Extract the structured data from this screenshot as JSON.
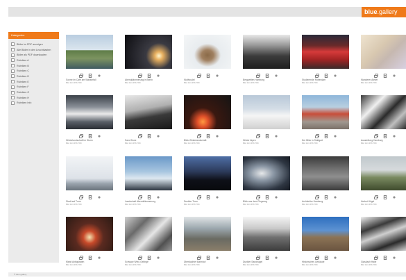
{
  "header": {
    "logo_bold": "blue",
    "logo_rest": ".gallery"
  },
  "sidebar": {
    "title": "Kategorien",
    "items": [
      {
        "label": "Bilder im PDF anzeigen"
      },
      {
        "label": "Alle Bilder in den Leuchtkasten"
      },
      {
        "label": "Bilder als PDF downloaden"
      },
      {
        "label": "Rubriken A"
      },
      {
        "label": "Rubriken B"
      },
      {
        "label": "Rubriken C"
      },
      {
        "label": "Rubriken D"
      },
      {
        "label": "Rubriken E"
      },
      {
        "label": "Rubriken F"
      },
      {
        "label": "Rubriken G"
      },
      {
        "label": "Rubriken H"
      },
      {
        "label": "Rubriken Info"
      }
    ]
  },
  "footer": {
    "text": "© blue.gallery"
  },
  "gallery": [
    {
      "caption": "Sonne im Café am Wasserfall",
      "meta": "Bild 123 456 789"
    },
    {
      "caption": "Abenddämmerung in Berlin",
      "meta": "Bild 123 456 789"
    },
    {
      "caption": "Wolfsrudel",
      "meta": "Bild 123 456 789"
    },
    {
      "caption": "Bergwelten Hamburg",
      "meta": "Bild 123 456 789"
    },
    {
      "caption": "Studierende Rotterdam",
      "meta": "Bild 123 456 789"
    },
    {
      "caption": "Wanderer Atelier",
      "meta": "Bild 123 456 789"
    },
    {
      "caption": "Winterlandschaft im Sturm",
      "meta": "Bild 123 456 789"
    },
    {
      "caption": "Sand Dune",
      "meta": "Bild 123 456 789"
    },
    {
      "caption": "Blick Winterlandschaft",
      "meta": "Bild 123 456 789"
    },
    {
      "caption": "Winter Alpen",
      "meta": "Bild 123 456 789"
    },
    {
      "caption": "Der Blick in Stuttgart",
      "meta": "Bild 123 456 789"
    },
    {
      "caption": "Ausstellung Hamburg",
      "meta": "Bild 123 456 789"
    },
    {
      "caption": "Stadt auf Turm",
      "meta": "Bild 123 456 789"
    },
    {
      "caption": "Landschaft Abenddämmerung",
      "meta": "Bild 123 456 789"
    },
    {
      "caption": "Dunkler Turm",
      "meta": "Bild 123 456 789"
    },
    {
      "caption": "Blick aus dem Flugzeug",
      "meta": "Bild 123 456 789"
    },
    {
      "caption": "Architektur Hamburg",
      "meta": "Bild 123 456 789"
    },
    {
      "caption": "Herbst Hügel",
      "meta": "Bild 123 456 789"
    },
    {
      "caption": "Markt Antiquitäten",
      "meta": "Bild 123 456 789"
    },
    {
      "caption": "Schwarz Weiß Gebirge",
      "meta": "Bild 123 456 789"
    },
    {
      "caption": "Überdachter Bahnhof",
      "meta": "Bild 123 456 789"
    },
    {
      "caption": "Dunkler Sandhügel",
      "meta": "Bild 123 456 789"
    },
    {
      "caption": "Historisches Gebäude",
      "meta": "Bild 123 456 789"
    },
    {
      "caption": "Glasdach Halle",
      "meta": "Bild 123 456 789"
    }
  ],
  "thumb_icons": [
    "lightbox-icon",
    "detail-icon",
    "add-icon"
  ],
  "colors": {
    "accent": "#ef7a1a",
    "bar": "#e4e4e4",
    "sidebar": "#ebebeb"
  }
}
